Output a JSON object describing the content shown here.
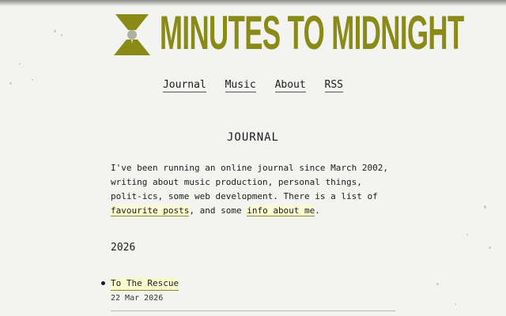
{
  "site": {
    "title": "MINUTES TO MIDNIGHT",
    "logo_icon": "radiation-trefoil-icon",
    "brand_color": "#8a8a16"
  },
  "nav": {
    "items": [
      {
        "label": "Journal"
      },
      {
        "label": "Music"
      },
      {
        "label": "About"
      },
      {
        "label": "RSS"
      }
    ]
  },
  "section": {
    "title": "JOURNAL"
  },
  "intro": {
    "text_before": "I've been running an online journal since March 2002, writing about music production, personal things, polit-ics, some web development. There is a list of ",
    "link_favourites": "favourite posts",
    "text_middle": ", and some ",
    "link_about": "info about me",
    "text_after": "."
  },
  "journal": {
    "year": "2026",
    "posts": [
      {
        "title": "To The Rescue",
        "date": "22 Mar 2026"
      }
    ]
  }
}
